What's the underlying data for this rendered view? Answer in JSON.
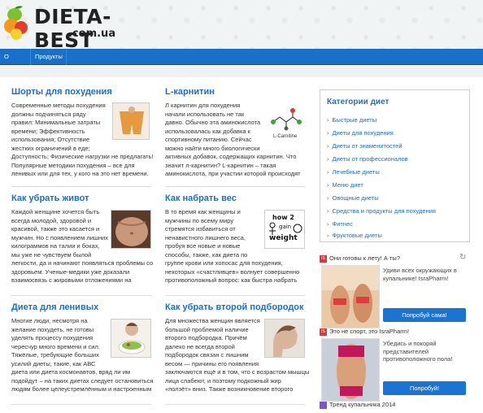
{
  "site": {
    "logo_title": "DIETA-BEST",
    "logo_sub": ".com.ua"
  },
  "nav": {
    "items": [
      "О сайте",
      "Продукты"
    ]
  },
  "articles": [
    {
      "title": "Шорты для похудения",
      "lines": [
        "Современные методы похудения",
        "должны подчиняться ряду",
        "правил: Минимальные затраты",
        "времени; Эффективность",
        "использования; Отсутствие",
        "жестких ограничений в еде;",
        "Доступность; Физические нагрузки не предлагать!",
        "Популярные методики похудения – все для",
        "ленивых или для тех, у кого на это нет времени."
      ],
      "thumb_icon": "shorts-photo"
    },
    {
      "title": "L-карнитин",
      "lines": [
        "Л карнитин для похудения",
        "начали использовать не так",
        "давно. Обычно эта аминокислота",
        "использовалась как добавка к",
        "спортивному питанию. Сейчас",
        "можно найти много биологически",
        "активных добавок, содержащих карнитин. Что",
        "значит л-карнитин? L-карнитин – такая",
        "аминокислота, при участии которой происходят"
      ],
      "thumb_caption": "L-Carnitine"
    },
    {
      "title": "Как убрать живот",
      "lines": [
        "Каждой женщине хочется быть",
        "всегда молодой, здоровой и",
        "красивой, также это касается и",
        "мужчин. Но с появлением лишних",
        "килограммов на талии и боках,",
        "мы уже не чувствуем былой",
        "легкости, да и начинают появляться проблемы со",
        "здоровьем. Ученые-медики уже доказали",
        "взаимосвязь с жировыми отложениями на"
      ]
    },
    {
      "title": "Как набрать вес",
      "lines": [
        "В то время как женщины и",
        "мужчины по всему миру",
        "стремятся избавиться от",
        "ненавистного лишнего веса,",
        "пробуя все новые и новые",
        "способы, также, как диета по",
        "группе крови или хопосас для похудения,",
        "некоторых «счастливцев» волнует совершенно",
        "противоположный вопрос: как быстра набрать"
      ],
      "thumb_text": [
        "how 2",
        "gain",
        "weight"
      ]
    },
    {
      "title": "Диета для ленивых",
      "lines": [
        "Многие люди, несмотря на",
        "желание похудеть, не готовы",
        "уделять процессу похудения",
        "чересчур много времени и сил.",
        "Тяжёлые, требующие больших",
        "усилий диеты, такие, как АВС",
        "диета или диета космонавтов, вряд ли им",
        "подойдут – на таких диетах следует остановиться",
        "людям более целеустремлённым и настроенным"
      ]
    },
    {
      "title": "Как убрать второй подбородок",
      "lines": [
        "Для множества женщин является",
        "большой проблемой наличие",
        "второго подбородка. Причём",
        "далеко не всегда второй",
        "подбородок связан с лишним",
        "весом — причины его появления",
        "заключаются ещё и в том, что с возрастом мышцы",
        "лица слабеют, и поэтому подкожный жир",
        "«ползёт» вниз. Также возникновение второго"
      ]
    }
  ],
  "sidebar": {
    "title": "Категории диет",
    "items": [
      "Быстрые диеты",
      "Диеты для похудения",
      "Диеты от знаменитостей",
      "Диеты от профессионалов",
      "Лечебные диеты",
      "Меню диет",
      "Овощные диеты",
      "Средства и продукты для похудения",
      "Фитнес",
      "Фруктовые диеты"
    ]
  },
  "ads": [
    {
      "headline": "Они готовы к лету! А ты?",
      "text": [
        "Удиви всех окружающих в",
        "купальнике! IsraPharm!"
      ],
      "button": "Попробуй сама!"
    },
    {
      "headline": "Это не спорт, это IsraPharm!",
      "text": [
        "Убедись и покоряй",
        "представителей",
        "противоположного пола!"
      ],
      "button": "Попробуй!"
    },
    {
      "headline": "Тренд купальника 2014"
    }
  ],
  "ad_badge": "IS",
  "colors": {
    "brand_blue": "#1a6fc8",
    "button_blue": "#1b74d2",
    "ad_badge": "#d43c3c"
  }
}
